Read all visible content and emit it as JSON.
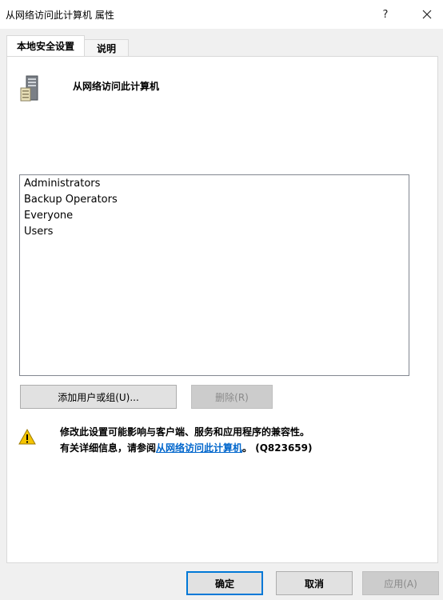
{
  "window": {
    "title": "从网络访问此计算机 属性",
    "help_glyph": "?",
    "close_glyph": "✕"
  },
  "tabs": [
    {
      "label": "本地安全设置",
      "active": true
    },
    {
      "label": "说明",
      "active": false
    }
  ],
  "policy": {
    "icon": "server-computer-icon",
    "name": "从网络访问此计算机"
  },
  "members": [
    "Administrators",
    "Backup Operators",
    "Everyone",
    "Users"
  ],
  "buttons": {
    "add": "添加用户或组(U)...",
    "remove": "删除(R)",
    "ok": "确定",
    "cancel": "取消",
    "apply": "应用(A)"
  },
  "warning": {
    "icon": "warning-icon",
    "line1": "修改此设置可能影响与客户端、服务和应用程序的兼容性。",
    "line2_prefix": "有关详细信息，请参阅",
    "link_text": "从网络访问此计算机",
    "line2_suffix": "。 (Q823659)"
  },
  "colors": {
    "link": "#0066cc",
    "accent_border": "#0078d7",
    "warning_yellow": "#f5c400"
  }
}
